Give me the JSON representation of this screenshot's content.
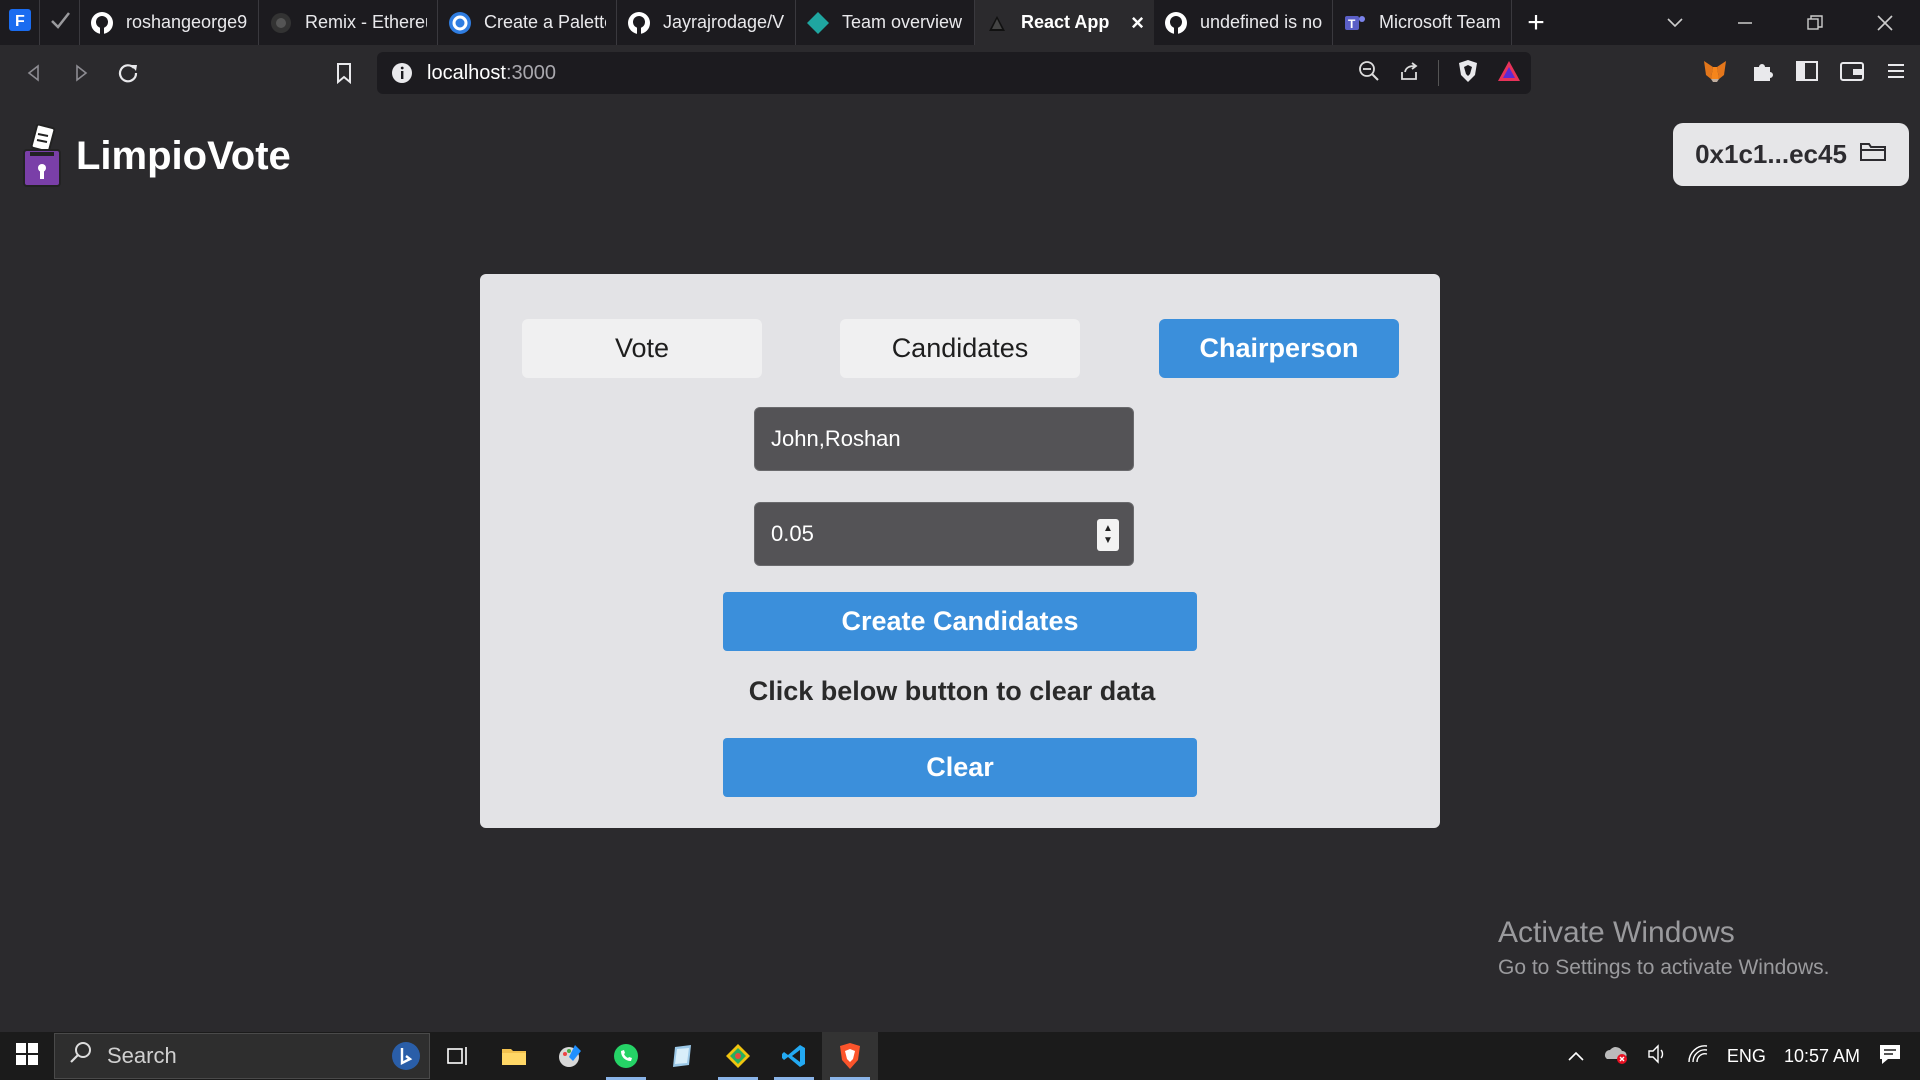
{
  "browser": {
    "tabs": [
      {
        "label": "",
        "favicon": "f-icon",
        "pinned": true
      },
      {
        "label": "",
        "favicon": "check-icon",
        "pinned": true
      },
      {
        "label": "roshangeorge9",
        "favicon": "github-icon"
      },
      {
        "label": "Remix - Ethereu",
        "favicon": "remix-icon"
      },
      {
        "label": "Create a Palette",
        "favicon": "canva-icon"
      },
      {
        "label": "Jayrajrodage/V",
        "favicon": "github-icon"
      },
      {
        "label": "Team overview",
        "favicon": "diamond-icon"
      },
      {
        "label": "React App",
        "favicon": "triangle-icon",
        "active": true
      },
      {
        "label": "undefined is no",
        "favicon": "github-icon"
      },
      {
        "label": "Microsoft Team",
        "favicon": "teams-icon"
      }
    ],
    "url_host": "localhost",
    "url_port": ":3000"
  },
  "app": {
    "brand": "LimpioVote",
    "wallet_address": "0x1c1...ec45",
    "tabs": {
      "vote": "Vote",
      "candidates": "Candidates",
      "chairperson": "Chairperson"
    },
    "selected_tab": "Chairperson",
    "candidates_input": "John,Roshan",
    "amount_input": "0.05",
    "create_button": "Create Candidates",
    "clear_hint": "Click below button to clear data",
    "clear_button": "Clear"
  },
  "watermark": {
    "line1": "Activate Windows",
    "line2": "Go to Settings to activate Windows."
  },
  "taskbar": {
    "search_placeholder": "Search",
    "language": "ENG",
    "time": "10:57 AM"
  },
  "colors": {
    "accent": "#3b8fdb",
    "panel": "#e3e3e6",
    "background": "#2b2a2d"
  }
}
